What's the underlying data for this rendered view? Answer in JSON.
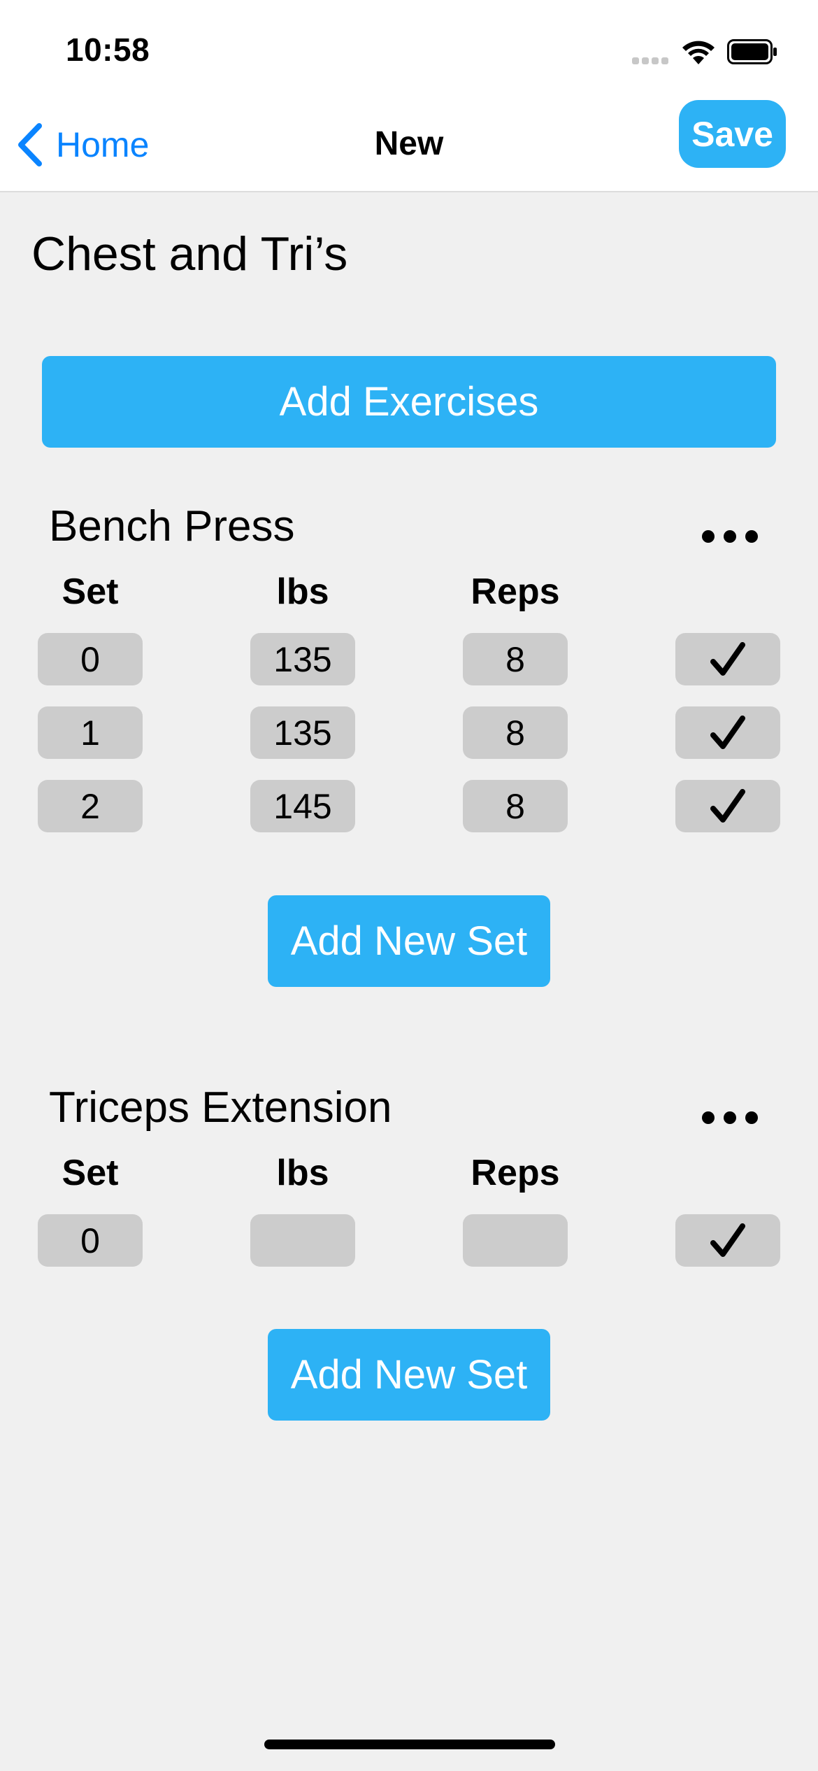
{
  "status_bar": {
    "time": "10:58"
  },
  "nav": {
    "back_label": "Home",
    "title": "New",
    "save_label": "Save"
  },
  "workout": {
    "title": "Chest and Tri’s",
    "add_exercises_label": "Add Exercises"
  },
  "columns": {
    "set": "Set",
    "lbs": "lbs",
    "reps": "Reps"
  },
  "exercises": [
    {
      "name": "Bench Press",
      "sets": [
        {
          "set": "0",
          "lbs": "135",
          "reps": "8"
        },
        {
          "set": "1",
          "lbs": "135",
          "reps": "8"
        },
        {
          "set": "2",
          "lbs": "145",
          "reps": "8"
        }
      ],
      "add_set_label": "Add New Set"
    },
    {
      "name": "Triceps Extension",
      "sets": [
        {
          "set": "0",
          "lbs": "",
          "reps": ""
        }
      ],
      "add_set_label": "Add New Set"
    }
  ],
  "colors": {
    "accent": "#2db2f5",
    "link": "#0a84ff",
    "background": "#f0f0f0",
    "field": "#cccccc"
  },
  "icons": {
    "back": "chevron-left-icon",
    "more": "ellipsis-icon",
    "check": "checkmark-icon"
  }
}
